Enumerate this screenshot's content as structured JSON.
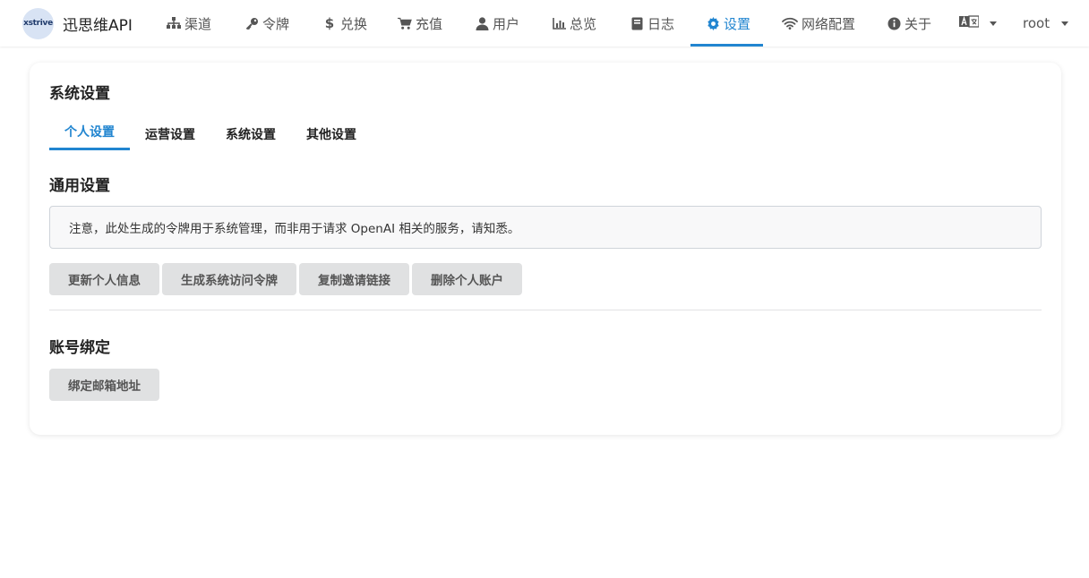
{
  "brand": {
    "logo_text": "xstrive",
    "name": "迅思维API"
  },
  "nav": {
    "items": [
      {
        "label": "渠道",
        "icon": "sitemap-icon"
      },
      {
        "label": "令牌",
        "icon": "key-icon"
      },
      {
        "label": "兑换",
        "icon": "dollar-icon"
      },
      {
        "label": "充值",
        "icon": "cart-icon"
      },
      {
        "label": "用户",
        "icon": "user-icon"
      },
      {
        "label": "总览",
        "icon": "bar-chart-icon"
      },
      {
        "label": "日志",
        "icon": "book-icon"
      },
      {
        "label": "设置",
        "icon": "gear-icon",
        "active": true
      },
      {
        "label": "网络配置",
        "icon": "wifi-icon"
      },
      {
        "label": "关于",
        "icon": "info-icon"
      }
    ],
    "user": "root",
    "accent": "#2185d0"
  },
  "page": {
    "title": "系统设置",
    "tabs": [
      "个人设置",
      "运营设置",
      "系统设置",
      "其他设置"
    ],
    "active_tab": 0,
    "general": {
      "heading": "通用设置",
      "notice": "注意，此处生成的令牌用于系统管理，而非用于请求 OpenAI 相关的服务，请知悉。",
      "buttons": [
        "更新个人信息",
        "生成系统访问令牌",
        "复制邀请链接",
        "删除个人账户"
      ]
    },
    "binding": {
      "heading": "账号绑定",
      "button": "绑定邮箱地址"
    }
  }
}
